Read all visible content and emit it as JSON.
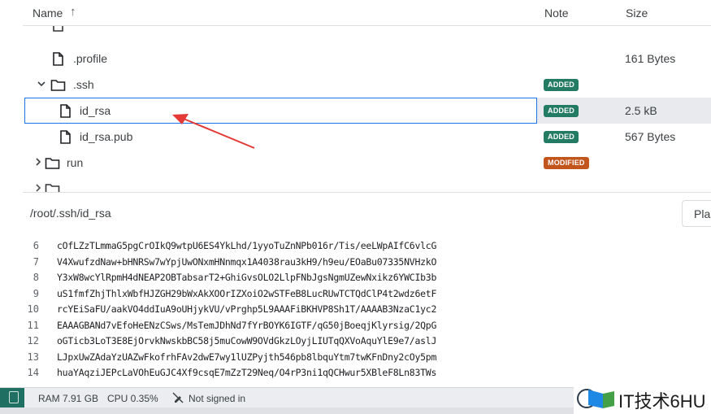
{
  "tree_header": {
    "name": "Name",
    "note": "Note",
    "size": "Size"
  },
  "tree_rows": [
    {
      "label": ".profile",
      "size": "161 Bytes",
      "badge": "",
      "type": "file"
    },
    {
      "label": ".ssh",
      "size": "",
      "badge": "ADDED",
      "type": "folder"
    },
    {
      "label": "id_rsa",
      "size": "2.5 kB",
      "badge": "ADDED",
      "type": "file"
    },
    {
      "label": "id_rsa.pub",
      "size": "567 Bytes",
      "badge": "ADDED",
      "type": "file"
    },
    {
      "label": "run",
      "size": "",
      "badge": "MODIFIED",
      "type": "folder"
    }
  ],
  "path_bar": {
    "path": "/root/.ssh/id_rsa",
    "button": "Pla"
  },
  "code_lines": [
    {
      "n": "6",
      "t": "cOfLZzTLmmaG5pgCrOIkQ9wtpU6ES4YkLhd/1yyoTuZnNPb016r/Tis/eeLWpAIfC6vlcG"
    },
    {
      "n": "7",
      "t": "V4XwufzdNaw+bHNRSw7wYpjUwONxmHNnmqx1A4038rau3kH9/h9eu/EOaBu07335NVHzkO"
    },
    {
      "n": "8",
      "t": "Y3xW8wcYlRpmH4dNEAP2OBTabsarT2+GhiGvsOLO2LlpFNbJgsNgmUZewNxikz6YWCIb3b"
    },
    {
      "n": "9",
      "t": "uS1fmfZhjThlxWbfHJZGH29bWxAkXOOrIZXoiO2wSTFeB8LucRUwTCTQdClP4t2wdz6etF"
    },
    {
      "n": "10",
      "t": "rcYEiSaFU/aakVO4ddIuA9oUHjykVU/vPrghp5L9AAAFiBKHVP8Sh1T/AAAAB3NzaC1yc2"
    },
    {
      "n": "11",
      "t": "EAAAGBANd7vEfoHeENzCSws/MsTemJDhNd7fYrBOYK6IGTF/qG50jBoeqjKlyrsig/2QpG"
    },
    {
      "n": "12",
      "t": "oGTicb3LoT3E8EjOrvkNwskbBC58j5muCowW9OVdGkzLOyjLIUTqQXVoAquYlE9e7/aslJ"
    },
    {
      "n": "13",
      "t": "LJpxUwZAdaYzUAZwFkofrhFAv2dwE7wy1lUZPyjth546pb8lbquYtm7twKFnDny2cOy5pm"
    },
    {
      "n": "14",
      "t": "huaYAqziJEPcLaVOhEuGJC4Xf9csqE7mZzT29Neq/O4rP3ni1qQCHwur5XBleF8Ln83TWs"
    }
  ],
  "status_bar": {
    "ram": "RAM 7.91 GB",
    "cpu": "CPU 0.35%",
    "sign": "Not signed in"
  },
  "watermark": {
    "text": "IT技术6HU"
  },
  "colors": {
    "added": "#237b63",
    "modified": "#c2551b",
    "selection": "#1a73e8",
    "arrow": "#e53935"
  },
  "icons": [
    "sort-arrow-up-icon",
    "chevron-down-icon",
    "chevron-right-icon",
    "folder-icon",
    "file-icon",
    "pen-off-icon"
  ]
}
